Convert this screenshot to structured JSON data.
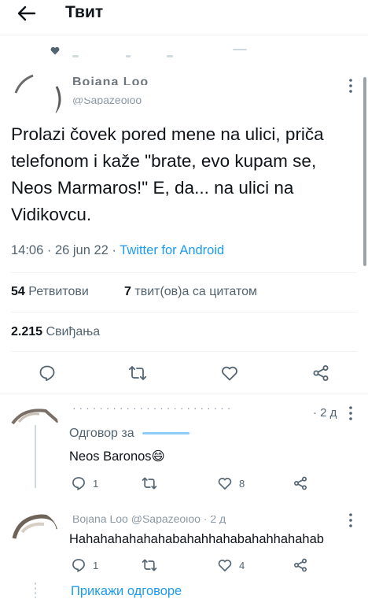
{
  "header": {
    "title": "Твит"
  },
  "tweet": {
    "author_name": "Bojana Loo",
    "author_handle": "@Sapazeoioo",
    "text": "Prolazi čovek pored mene na ulici, priča telefonom i kaže \"brate, evo kupam se, Neos Marmaros!\" E, da... na ulici na Vidikovcu.",
    "time": "14:06 · 26 jun 22 · ",
    "source": "Twitter for Android",
    "retweets_count": "54",
    "retweets_label": "Ретвитови",
    "quotes_count": "7",
    "quotes_label": "твит(ов)а са цитатом",
    "likes_count": "2.215",
    "likes_label": "Свиђања"
  },
  "replies": [
    {
      "header": "· · · · · · · · · · · · · · · · · · · · · · · ·",
      "time": "· 2 д",
      "replying_label": "Одговор за",
      "text": "Neos Baronos😄",
      "reply_count": "1",
      "retweet_count": "",
      "like_count": "8"
    },
    {
      "header": "Bojana Loo @Sapazeoioo · 2 д",
      "time": "",
      "replying_label": "",
      "text": "Hahahahahahahabahahhahabahahhahahab",
      "reply_count": "1",
      "retweet_count": "",
      "like_count": "4"
    }
  ],
  "show_replies": "Прикажи одговоре",
  "colors": {
    "accent": "#1d9bf0",
    "text": "#0f1419",
    "muted": "#536471",
    "divider": "#eff3f4"
  }
}
